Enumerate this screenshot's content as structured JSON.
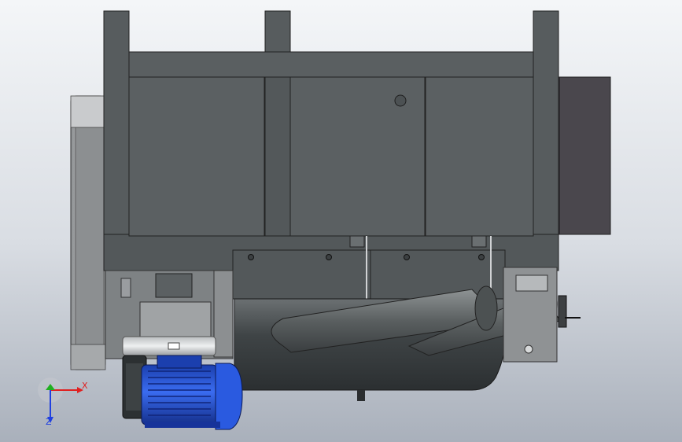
{
  "viewport": {
    "background_top": "#f4f6f8",
    "background_bottom": "#a9b0bb"
  },
  "colors": {
    "frame": "#4f5456",
    "frame_dark": "#3d4244",
    "panel": "#5a5f61",
    "motor_blue": "#1e4fd0",
    "side_wheel": "#b3b5b7",
    "rear_block": "#4a474d",
    "axis_x": "#e02020",
    "axis_y": "#20b020",
    "axis_z": "#2040e0"
  },
  "triad": {
    "x_label": "X",
    "z_label": "Z",
    "icon": "view-orientation-triad-icon"
  }
}
